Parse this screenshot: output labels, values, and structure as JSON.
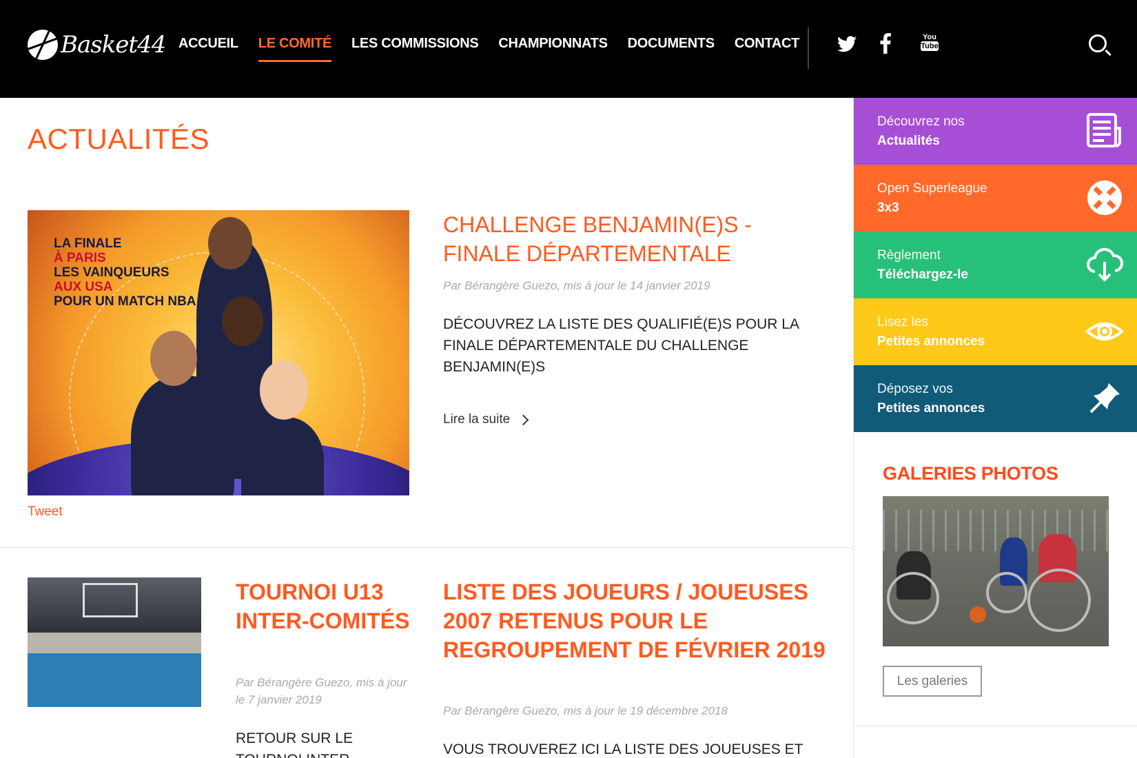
{
  "header": {
    "logo_text": "Basket44",
    "nav": [
      {
        "label": "ACCUEIL",
        "active": false
      },
      {
        "label": "LE COMITÉ",
        "active": true
      },
      {
        "label": "LES COMMISSIONS",
        "active": false
      },
      {
        "label": "CHAMPIONNATS",
        "active": false
      },
      {
        "label": "DOCUMENTS",
        "active": false
      },
      {
        "label": "CONTACT",
        "active": false
      }
    ],
    "social": {
      "twitter_icon": "twitter-icon",
      "facebook_icon": "facebook-icon",
      "youtube_icon": "youtube-icon",
      "youtube_line1": "You",
      "youtube_line2": "Tube"
    },
    "search_icon": "search-icon"
  },
  "main": {
    "page_title": "ACTUALITÉS",
    "featured": {
      "image_text": {
        "l1": "LA FINALE",
        "l2": "À PARIS",
        "l3": "LES VAINQUEURS",
        "l4": "AUX USA",
        "l5": "POUR UN MATCH NBA"
      },
      "title": "CHALLENGE BENJAMIN(E)S - FINALE DÉPARTEMENTALE",
      "meta": "Par Bérangère Guezo, mis à jour le 14 janvier 2019",
      "summary": "DÉCOUVREZ LA LISTE DES QUALIFIÉ(E)S POUR LA FINALE DÉPARTEMENTALE DU CHALLENGE BENJAMIN(E)S",
      "read_more": "Lire la suite",
      "tweet": "Tweet"
    },
    "article2": {
      "title": "TOURNOI U13 INTER-COMITÉS",
      "meta": "Par Bérangère Guezo, mis à jour le 7 janvier 2019",
      "summary": "RETOUR SUR LE TOURNOI INTER"
    },
    "article3": {
      "title": "LISTE DES JOUEURS / JOUEUSES 2007 RETENUS POUR LE REGROUPEMENT DE FÉVRIER 2019",
      "meta": "Par Bérangère Guezo, mis à jour le 19 décembre 2018",
      "summary": "VOUS TROUVEREZ ICI LA LISTE DES JOUEUSES ET"
    }
  },
  "sidebar": {
    "tiles": [
      {
        "line1": "Découvrez nos",
        "line2": "Actualités",
        "color": "#a64fd6",
        "icon": "newspaper-icon"
      },
      {
        "line1": "Open Superleague",
        "line2": "3x3",
        "color": "#ff6a2b",
        "icon": "3x3-ball-icon"
      },
      {
        "line1": "Règlement",
        "line2": "Téléchargez-le",
        "color": "#27c07a",
        "icon": "cloud-download-icon"
      },
      {
        "line1": "Lisez les",
        "line2": "Petites annonces",
        "color": "#ffc91a",
        "icon": "eye-icon"
      },
      {
        "line1": "Déposez vos",
        "line2": "Petites annonces",
        "color": "#0f5b78",
        "icon": "pin-icon"
      }
    ],
    "gallery": {
      "title": "GALERIES PHOTOS",
      "button": "Les galeries"
    }
  },
  "colors": {
    "accent": "#ff5a1f",
    "header_bg": "#000000"
  }
}
